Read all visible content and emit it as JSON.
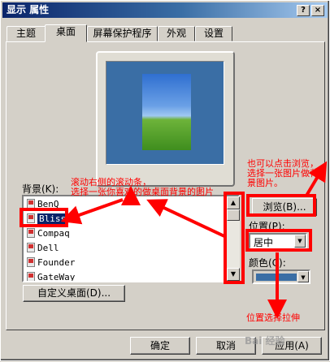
{
  "window": {
    "title": "显示 属性",
    "help_btn": "?",
    "close_btn": "×"
  },
  "tabs": [
    {
      "label": "主题"
    },
    {
      "label": "桌面"
    },
    {
      "label": "屏幕保护程序"
    },
    {
      "label": "外观"
    },
    {
      "label": "设置"
    }
  ],
  "background": {
    "label": "背景(K):",
    "items": [
      {
        "label": "BenQ"
      },
      {
        "label": "Bliss",
        "selected": true
      },
      {
        "label": "Compaq"
      },
      {
        "label": "Dell"
      },
      {
        "label": "Founder"
      },
      {
        "label": "GateWay"
      }
    ]
  },
  "browse_button": "浏览(B)...",
  "position": {
    "label": "位置(P):",
    "value": "居中"
  },
  "color": {
    "label": "颜色(C):",
    "swatch": "#3a6ea5"
  },
  "customize_button": "自定义桌面(D)...",
  "footer": {
    "ok": "确定",
    "cancel": "取消",
    "apply": "应用(A)"
  },
  "annotations": {
    "scroll_note_1": "滚动右侧的滚动条，",
    "scroll_note_2": "选择一张你喜欢的做桌面背景的图片",
    "browse_note_1": "也可以点击浏览，",
    "browse_note_2": "选择一张图片做背",
    "browse_note_3": "景图片。",
    "position_note": "位置选择拉伸"
  },
  "colors": {
    "annotation": "#ff0000",
    "title_bar": "#0a246a"
  },
  "watermark": "Bai 经验"
}
